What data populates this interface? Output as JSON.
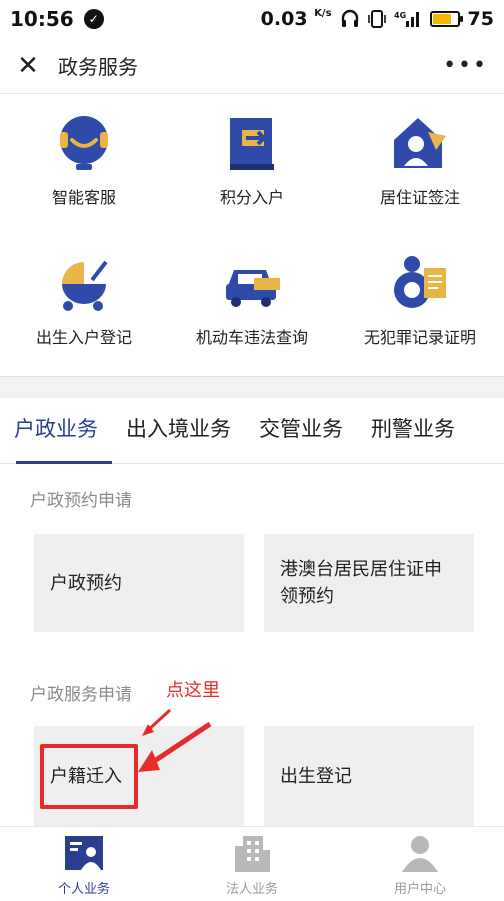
{
  "status": {
    "time": "10:56",
    "speed": "0.03",
    "speed_unit": "K/s",
    "network": "4G",
    "battery": "75",
    "battery_level": 0.75
  },
  "titlebar": {
    "title": "政务服务",
    "close_icon": "close-icon",
    "more_icon": "more-icon"
  },
  "services": [
    {
      "label": "智能客服",
      "icon": "customer-service-icon"
    },
    {
      "label": "积分入户",
      "icon": "points-household-icon"
    },
    {
      "label": "居住证签注",
      "icon": "residence-permit-icon"
    },
    {
      "label": "出生入户登记",
      "icon": "birth-registration-icon"
    },
    {
      "label": "机动车违法查询",
      "icon": "vehicle-violation-icon"
    },
    {
      "label": "无犯罪记录证明",
      "icon": "no-crime-record-icon"
    }
  ],
  "tabs": [
    {
      "label": "户政业务",
      "active": true
    },
    {
      "label": "出入境业务",
      "active": false
    },
    {
      "label": "交管业务",
      "active": false
    },
    {
      "label": "刑警业务",
      "active": false
    }
  ],
  "sections": {
    "appointment_label": "户政预约申请",
    "appointment_cards": [
      "户政预约",
      "港澳台居民居住证申领预约"
    ],
    "service_label": "户政服务申请",
    "service_cards": [
      "户籍迁入",
      "出生登记"
    ]
  },
  "annotation": {
    "hint": "点这里",
    "color": "#e52b2b"
  },
  "bottomnav": [
    {
      "label": "个人业务",
      "icon": "personal-id-icon",
      "active": true
    },
    {
      "label": "法人业务",
      "icon": "building-icon",
      "active": false
    },
    {
      "label": "用户中心",
      "icon": "user-icon",
      "active": false
    }
  ],
  "colors": {
    "accent": "#2a3f8f",
    "icon_dark": "#2f4aa8",
    "icon_yellow": "#e8b547"
  }
}
